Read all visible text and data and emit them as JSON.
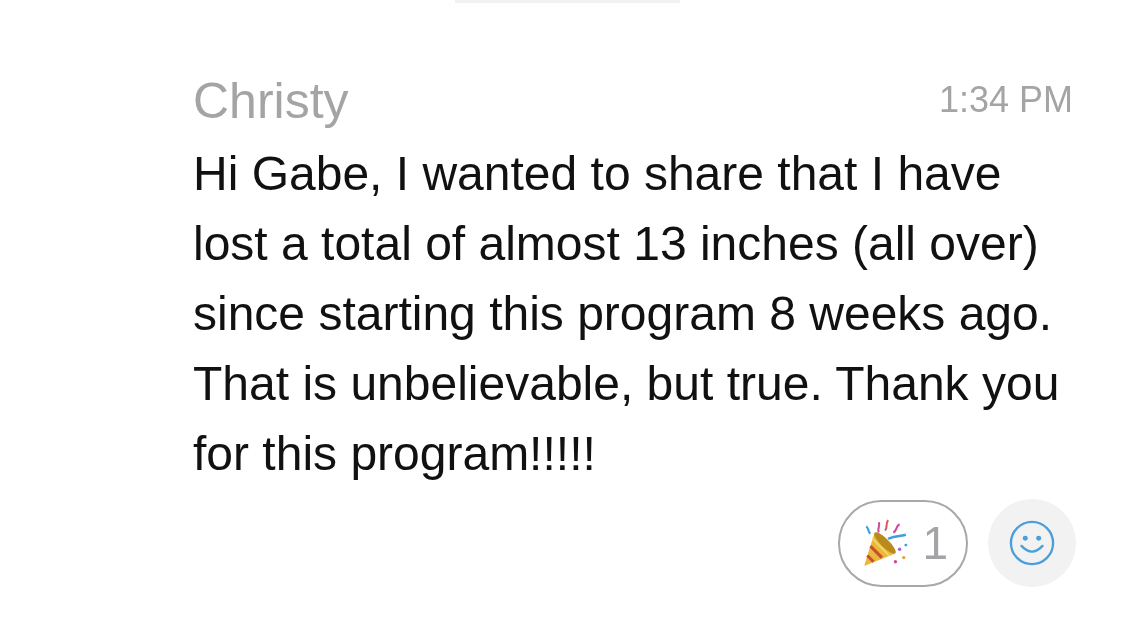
{
  "message": {
    "author": "Christy",
    "time": "1:34 PM",
    "text": "Hi Gabe, I wanted to share that I have lost a total of almost 13 inches (all over) since starting this program 8 weeks ago. That is unbelievable, but true. Thank you for this program!!!!!",
    "reactions": [
      {
        "kind": "party",
        "count": "1"
      }
    ]
  }
}
